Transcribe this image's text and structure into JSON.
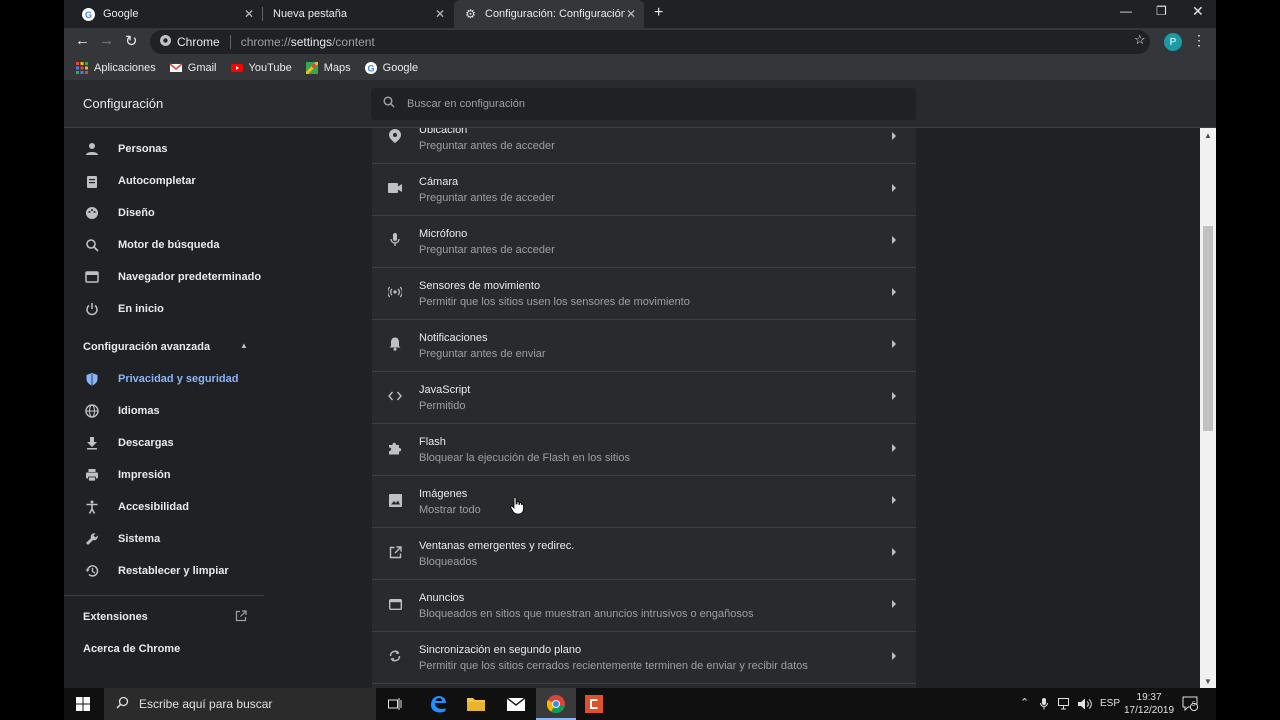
{
  "browser": {
    "tabs": [
      {
        "title": "Google",
        "active": false
      },
      {
        "title": "Nueva pestaña",
        "active": false
      },
      {
        "title": "Configuración: Configuración del",
        "active": true
      }
    ],
    "omnibox": {
      "site_label": "Chrome",
      "url_prefix": "chrome://",
      "url_host": "settings",
      "url_path": "/content"
    },
    "profile_initial": "P",
    "bookmarks": [
      "Aplicaciones",
      "Gmail",
      "YouTube",
      "Maps",
      "Google"
    ]
  },
  "settings": {
    "title": "Configuración",
    "search_placeholder": "Buscar en configuración",
    "nav": [
      {
        "label": "Personas",
        "icon": "person-icon"
      },
      {
        "label": "Autocompletar",
        "icon": "clipboard-icon"
      },
      {
        "label": "Diseño",
        "icon": "palette-icon"
      },
      {
        "label": "Motor de búsqueda",
        "icon": "search-icon"
      },
      {
        "label": "Navegador predeterminado",
        "icon": "browser-icon"
      },
      {
        "label": "En inicio",
        "icon": "power-icon"
      }
    ],
    "advanced_label": "Configuración avanzada",
    "advanced_nav": [
      {
        "label": "Privacidad y seguridad",
        "icon": "shield-icon",
        "selected": true
      },
      {
        "label": "Idiomas",
        "icon": "globe-icon"
      },
      {
        "label": "Descargas",
        "icon": "download-icon"
      },
      {
        "label": "Impresión",
        "icon": "printer-icon"
      },
      {
        "label": "Accesibilidad",
        "icon": "accessibility-icon"
      },
      {
        "label": "Sistema",
        "icon": "wrench-icon"
      },
      {
        "label": "Restablecer y limpiar",
        "icon": "history-icon"
      }
    ],
    "extensions_label": "Extensiones",
    "about_label": "Acerca de Chrome",
    "rows": [
      {
        "title": "Ubicación",
        "subtitle": "Preguntar antes de acceder",
        "icon": "location-icon"
      },
      {
        "title": "Cámara",
        "subtitle": "Preguntar antes de acceder",
        "icon": "camera-icon"
      },
      {
        "title": "Micrófono",
        "subtitle": "Preguntar antes de acceder",
        "icon": "mic-icon"
      },
      {
        "title": "Sensores de movimiento",
        "subtitle": "Permitir que los sitios usen los sensores de movimiento",
        "icon": "sensors-icon"
      },
      {
        "title": "Notificaciones",
        "subtitle": "Preguntar antes de enviar",
        "icon": "bell-icon"
      },
      {
        "title": "JavaScript",
        "subtitle": "Permitido",
        "icon": "code-icon"
      },
      {
        "title": "Flash",
        "subtitle": "Bloquear la ejecución de Flash en los sitios",
        "icon": "puzzle-icon"
      },
      {
        "title": "Imágenes",
        "subtitle": "Mostrar todo",
        "icon": "image-icon"
      },
      {
        "title": "Ventanas emergentes y redirec.",
        "subtitle": "Bloqueados",
        "icon": "open-in-new-icon"
      },
      {
        "title": "Anuncios",
        "subtitle": "Bloqueados en sitios que muestran anuncios intrusivos o engañosos",
        "icon": "ad-icon"
      },
      {
        "title": "Sincronización en segundo plano",
        "subtitle": "Permitir que los sitios cerrados recientemente terminen de enviar y recibir datos",
        "icon": "sync-icon"
      }
    ]
  },
  "taskbar": {
    "search_placeholder": "Escribe aquí para buscar",
    "language": "ESP",
    "time": "19:37",
    "date": "17/12/2019",
    "notification_count": "5"
  }
}
